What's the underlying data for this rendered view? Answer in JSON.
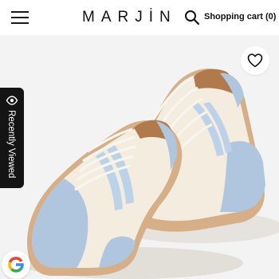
{
  "header": {
    "brand": "MARJİN",
    "cart_label": "Shopping cart (0)"
  },
  "sidebar_tab": {
    "label": "Recently Viewed"
  },
  "icons": {
    "menu": "hamburger-menu-icon",
    "search": "search-icon",
    "favorite": "heart-outline-icon",
    "recently_viewed": "eye-icon",
    "google": "google-g-icon"
  },
  "colors": {
    "leather": "#f3ecdf",
    "suede": "#afc6de",
    "stripe": "#bcd2e8",
    "gum_sole": "#d6ae87",
    "lining": "#b17a4c",
    "background": "#f3f3f3",
    "tab": "#141414"
  }
}
